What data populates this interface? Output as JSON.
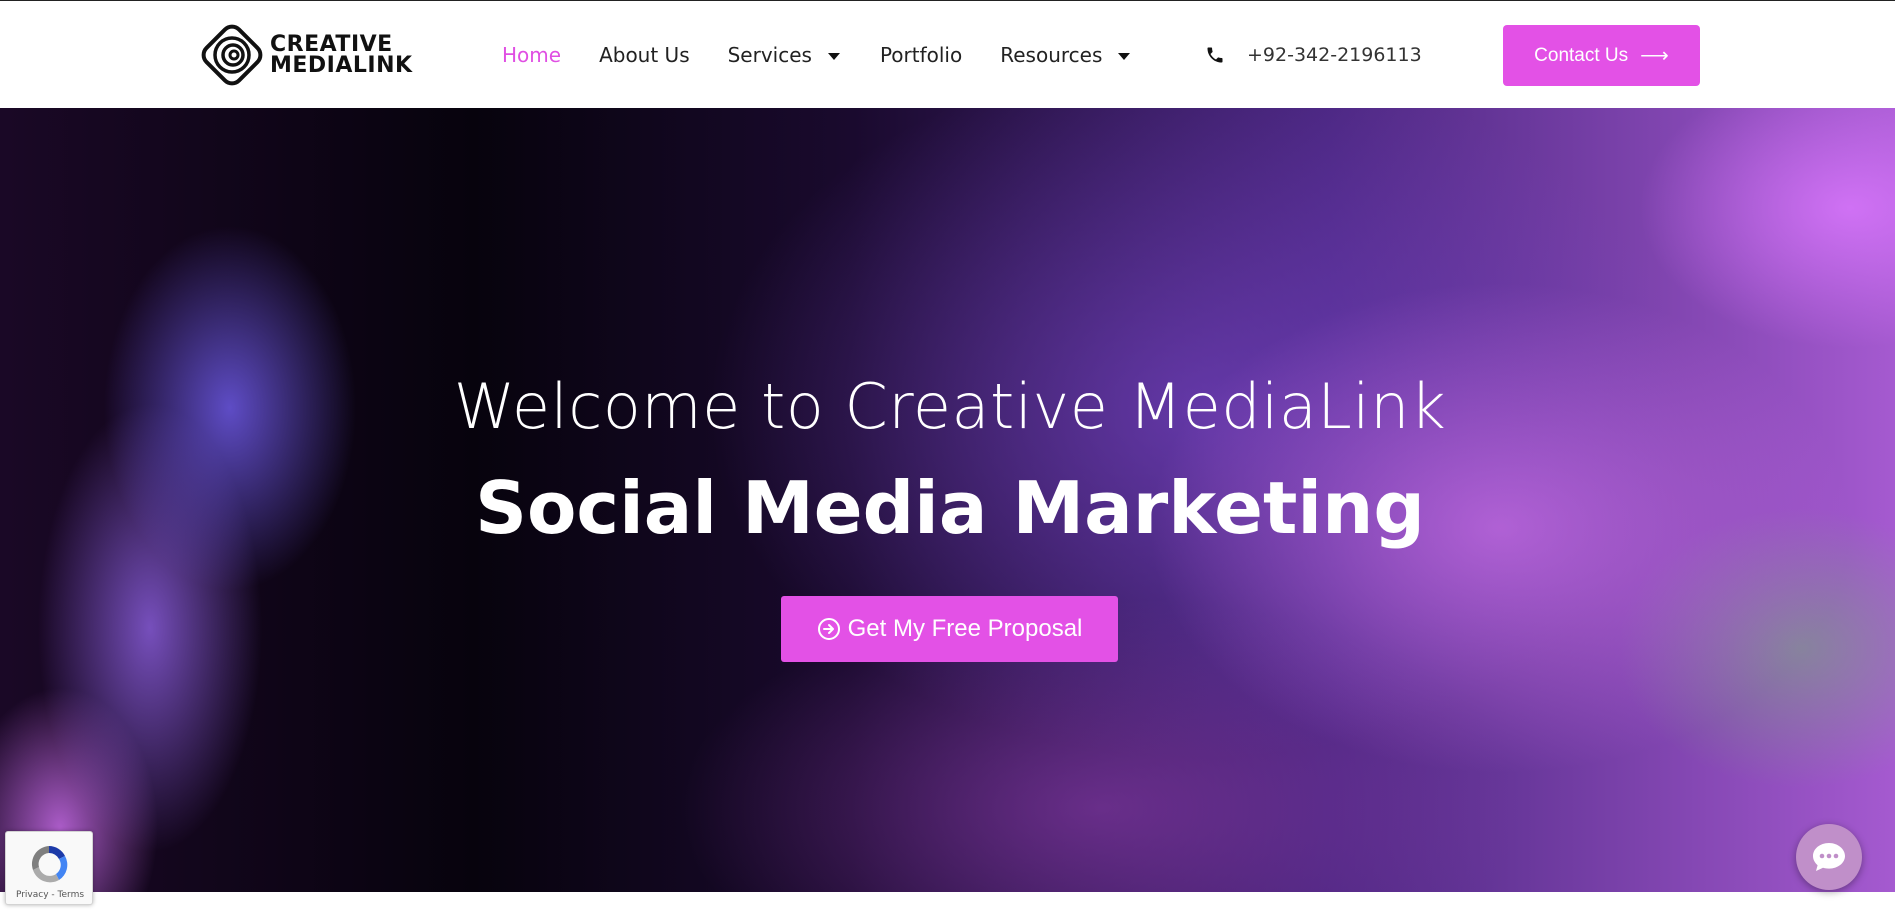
{
  "brand": {
    "line1": "CREATIVE",
    "line2": "MEDIALINK"
  },
  "nav": {
    "items": [
      {
        "label": "Home",
        "active": true
      },
      {
        "label": "About Us"
      },
      {
        "label": "Services",
        "dropdown": true
      },
      {
        "label": "Portfolio"
      },
      {
        "label": "Resources",
        "dropdown": true
      }
    ]
  },
  "phone": {
    "number": "+92-342-2196113",
    "icon": "phone-icon"
  },
  "contact_button": {
    "label": "Contact Us",
    "icon": "arrow-right-icon"
  },
  "hero": {
    "title": "Welcome to Creative MediaLink",
    "subtitle": "Social Media Marketing",
    "cta_label": "Get My Free Proposal",
    "cta_icon": "circle-arrow-right-icon"
  },
  "recaptcha": {
    "privacy": "Privacy",
    "separator": "-",
    "terms": "Terms"
  },
  "chat": {
    "icon": "chat-bubble-icon"
  },
  "colors": {
    "accent": "#e351e6",
    "nav_active": "#e04fe3",
    "text": "#222222"
  }
}
